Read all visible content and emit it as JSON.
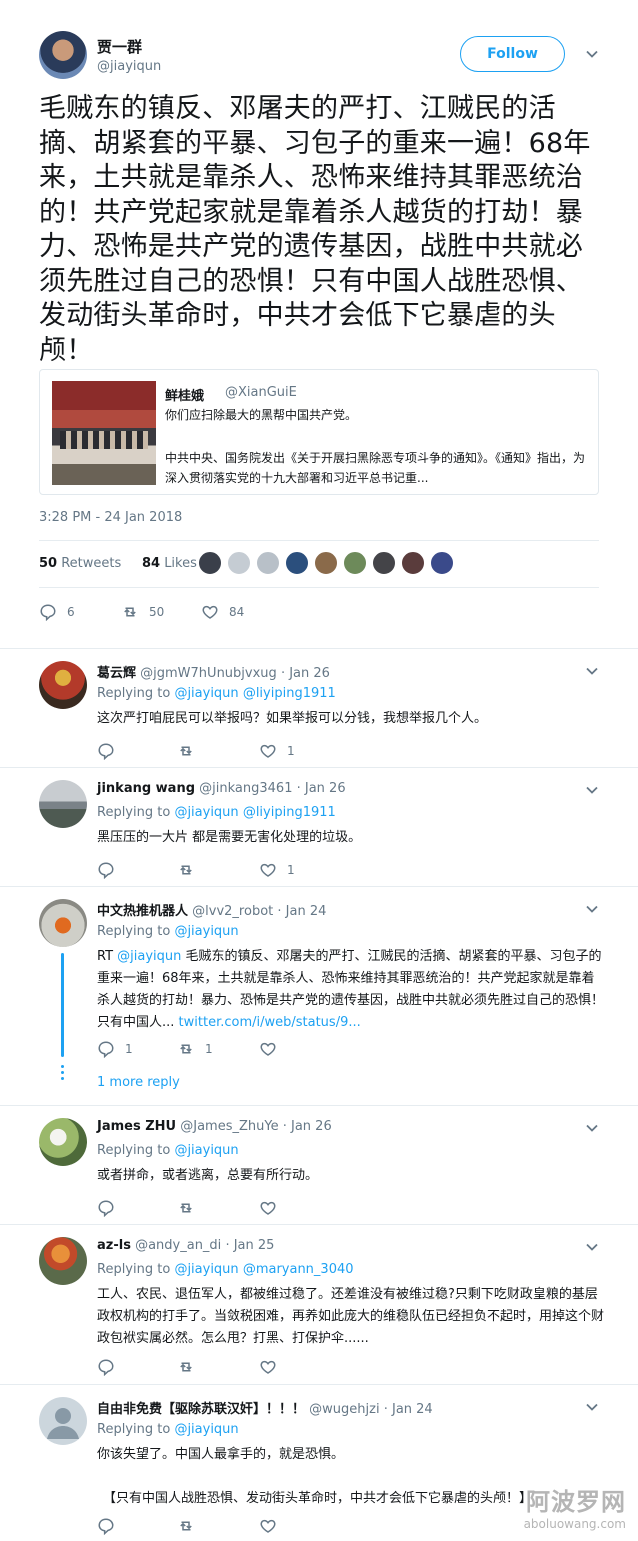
{
  "main_tweet": {
    "author_name": "贾一群",
    "author_handle": "@jiayiqun",
    "follow_label": "Follow",
    "text": "毛贼东的镇反、邓屠夫的严打、江贼民的活摘、胡紧套的平暴、习包子的重来一遍！68年来，土共就是靠杀人、恐怖来维持其罪恶统治的！共产党起家就是靠着杀人越货的打劫！暴力、恐怖是共产党的遗传基因，战胜中共就必须先胜过自己的恐惧！只有中国人战胜恐惧、发动街头革命时，中共才会低下它暴虐的头颅！",
    "quote": {
      "author_name": "鲜桂娥",
      "author_handle": "@XianGuiE",
      "line1": "你们应扫除最大的黑帮中国共产党。",
      "line2": "中共中央、国务院发出《关于开展扫黑除恶专项斗争的通知》。《通知》指出，为深入贯彻落实党的十九大部署和习近平总书记重..."
    },
    "timestamp": "3:28 PM - 24 Jan 2018",
    "retweets_count": "50",
    "retweets_label": "Retweets",
    "likes_count": "84",
    "likes_label": "Likes",
    "reply_count": "6",
    "retweet_count": "50",
    "like_count": "84",
    "liker_colors": [
      "#3a3f4a",
      "#c5ccd3",
      "#b8c0c8",
      "#2b4f7d",
      "#8a6a4a",
      "#6d8a5a",
      "#444448",
      "#5a3c3c",
      "#3a4a8a"
    ]
  },
  "replies": [
    {
      "author_name": "葛云辉",
      "author_handle": "@jgmW7hUnubjvxug",
      "date": "Jan 26",
      "replying_prefix": "Replying to",
      "replying_to": [
        "@jiayiqun",
        "@liyiping1911"
      ],
      "text": "这次严打咱屁民可以举报吗？如果举报可以分钱，我想举报几个人。",
      "reply_count": "",
      "retweet_count": "",
      "like_count": "1",
      "avatar_color": "#b33a2a"
    },
    {
      "author_name": "jinkang wang",
      "author_handle": "@jinkang3461",
      "date": "Jan 26",
      "replying_prefix": "Replying to",
      "replying_to": [
        "@jiayiqun",
        "@liyiping1911"
      ],
      "text": "黑压压的一大片 都是需要无害化处理的垃圾。",
      "reply_count": "",
      "retweet_count": "",
      "like_count": "1",
      "avatar_color": "#8a9298"
    },
    {
      "author_name": "中文热推机器人",
      "author_handle": "@lvv2_robot",
      "date": "Jan 24",
      "replying_prefix": "Replying to",
      "replying_to": [
        "@jiayiqun"
      ],
      "text_prefix": "RT ",
      "text_mention": "@jiayiqun",
      "text": " 毛贼东的镇反、邓屠夫的严打、江贼民的活摘、胡紧套的平暴、习包子的重来一遍！68年来，土共就是靠杀人、恐怖来维持其罪恶统治的！共产党起家就是靠着杀人越货的打劫！暴力、恐怖是共产党的遗传基因，战胜中共就必须先胜过自己的恐惧！只有中国人... ",
      "text_link": "twitter.com/i/web/status/9...",
      "reply_count": "1",
      "retweet_count": "1",
      "like_count": "",
      "more_replies": "1 more reply",
      "avatar_color": "#d0cfc8"
    },
    {
      "author_name": "James ZHU",
      "author_handle": "@James_ZhuYe",
      "date": "Jan 26",
      "replying_prefix": "Replying to",
      "replying_to": [
        "@jiayiqun"
      ],
      "text": "或者拼命，或者逃离，总要有所行动。",
      "reply_count": "",
      "retweet_count": "",
      "like_count": "",
      "avatar_color": "#7a9a5a"
    },
    {
      "author_name": "az-ls",
      "author_handle": "@andy_an_di",
      "date": "Jan 25",
      "replying_prefix": "Replying to",
      "replying_to": [
        "@jiayiqun",
        "@maryann_3040"
      ],
      "text": "工人、农民、退伍军人，都被维过稳了。还差谁没有被维过稳?只剩下吃财政皇粮的基层政权机构的打手了。当敛税困难，再养如此庞大的维稳队伍已经担负不起时，用掉这个财政包袱实属必然。怎么甩？打黑、打保护伞......",
      "reply_count": "",
      "retweet_count": "",
      "like_count": "",
      "avatar_color": "#d6763a"
    },
    {
      "author_name": "自由非免费【驱除苏联汉奸】！！！",
      "author_handle": "@wugehjzi",
      "date": "Jan 24",
      "replying_prefix": "Replying to",
      "replying_to": [
        "@jiayiqun"
      ],
      "text": "你该失望了。中国人最拿手的，就是恐惧。",
      "text2": "【只有中国人战胜恐惧、发动街头革命时，中共才会低下它暴虐的头颅！】",
      "reply_count": "",
      "retweet_count": "",
      "like_count": "",
      "avatar_color": "#ccd6dd"
    }
  ],
  "watermark": {
    "cn": "阿波罗网",
    "en": "aboluowang.com"
  }
}
